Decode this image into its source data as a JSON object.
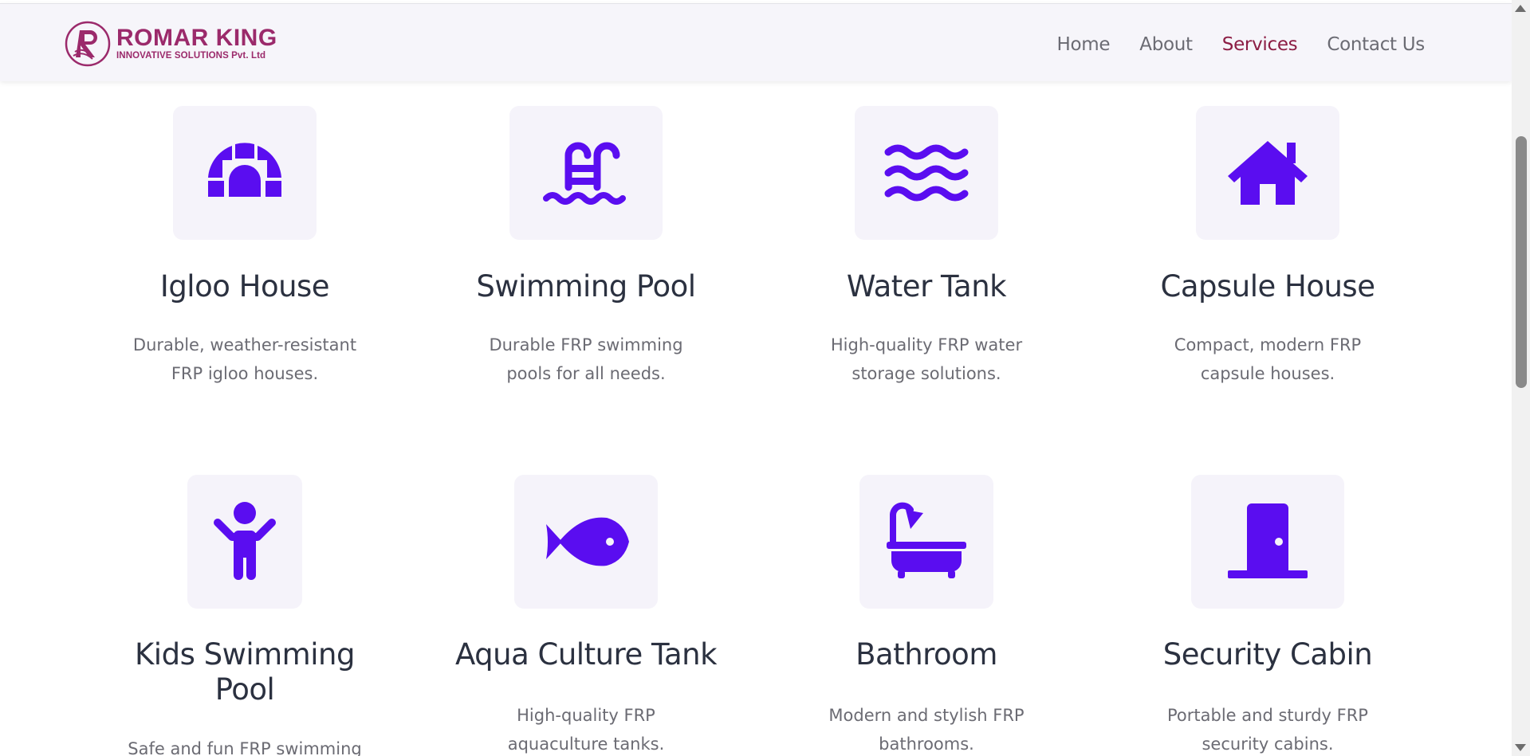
{
  "brand": {
    "name": "ROMAR KING",
    "subtitle": "INNOVATIVE SOLUTIONS Pvt. Ltd",
    "color": "#9b2a6b"
  },
  "nav": {
    "items": [
      {
        "label": "Home",
        "active": false
      },
      {
        "label": "About",
        "active": false
      },
      {
        "label": "Services",
        "active": true
      },
      {
        "label": "Contact Us",
        "active": false
      }
    ],
    "active_color": "#8c1d44"
  },
  "accent_color": "#5a0df0",
  "services": [
    {
      "icon": "igloo-icon",
      "title": "Igloo House",
      "desc_line1": "Durable, weather-resistant",
      "desc_line2": "FRP igloo houses."
    },
    {
      "icon": "swimming-pool-icon",
      "title": "Swimming Pool",
      "desc_line1": "Durable FRP swimming",
      "desc_line2": "pools for all needs."
    },
    {
      "icon": "water-waves-icon",
      "title": "Water Tank",
      "desc_line1": "High-quality FRP water",
      "desc_line2": "storage solutions."
    },
    {
      "icon": "house-icon",
      "title": "Capsule House",
      "desc_line1": "Compact, modern FRP",
      "desc_line2": "capsule houses."
    },
    {
      "icon": "child-icon",
      "title_line1": "Kids Swimming",
      "title_line2": "Pool",
      "desc_line1": "Safe and fun FRP swimming",
      "desc_line2": ""
    },
    {
      "icon": "fish-icon",
      "title": "Aqua Culture Tank",
      "desc_line1": "High-quality FRP",
      "desc_line2": "aquaculture tanks."
    },
    {
      "icon": "bathtub-icon",
      "title": "Bathroom",
      "desc_line1": "Modern and stylish FRP",
      "desc_line2": "bathrooms."
    },
    {
      "icon": "door-icon",
      "title": "Security Cabin",
      "desc_line1": "Portable and sturdy FRP",
      "desc_line2": "security cabins."
    }
  ]
}
